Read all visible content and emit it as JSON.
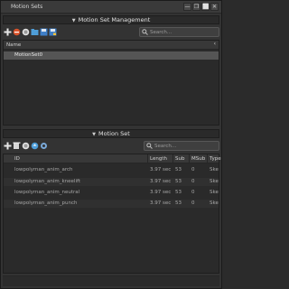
{
  "window": {
    "title": "Motion Sets",
    "buttons": [
      {
        "glyph": "—",
        "name": "minimize-button"
      },
      {
        "glyph": "❐",
        "name": "restore-button"
      },
      {
        "glyph": "⬜",
        "name": "maximize-button"
      },
      {
        "glyph": "✕",
        "name": "close-button"
      }
    ]
  },
  "management": {
    "header": "Motion Set Management",
    "search_placeholder": "Search...",
    "columns": {
      "name": "Name"
    },
    "rows": [
      {
        "name": "MotionSet0"
      }
    ],
    "toolbar_icons": [
      "add-icon",
      "remove-icon",
      "clear-icon",
      "open-folder-icon",
      "save-icon",
      "save-as-icon"
    ]
  },
  "motion_set": {
    "header": "Motion Set",
    "search_placeholder": "Search...",
    "columns": {
      "id": "ID",
      "length": "Length",
      "sub": "Sub",
      "msub": "MSub",
      "type": "Type"
    },
    "rows": [
      {
        "id": "lowpolyman_anim_arch",
        "length": "3.97 sec",
        "sub": "53",
        "msub": "0",
        "type": "Skele"
      },
      {
        "id": "lowpolyman_anim_kneelift",
        "length": "3.97 sec",
        "sub": "53",
        "msub": "0",
        "type": "Skele"
      },
      {
        "id": "lowpolyman_anim_neutral",
        "length": "3.97 sec",
        "sub": "53",
        "msub": "0",
        "type": "Skele"
      },
      {
        "id": "lowpolyman_anim_punch",
        "length": "3.97 sec",
        "sub": "53",
        "msub": "0",
        "type": "Skele"
      }
    ],
    "toolbar_icons": [
      "add-icon",
      "remove-icon",
      "clear-icon",
      "open-icon",
      "settings-icon"
    ]
  }
}
